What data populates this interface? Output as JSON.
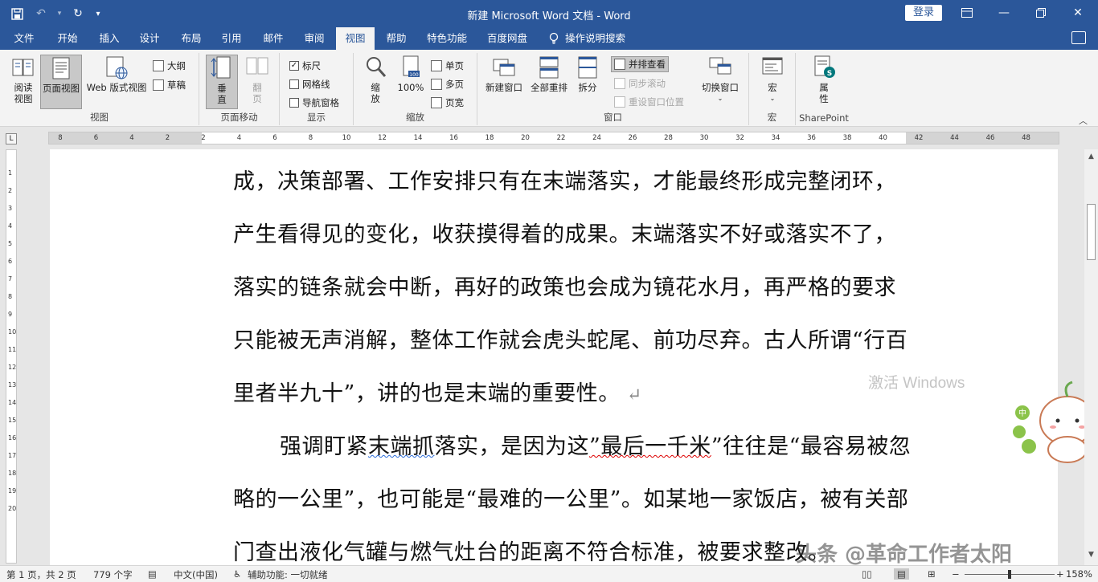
{
  "window": {
    "title": "新建 Microsoft Word 文档  -  Word",
    "login_label": "登录"
  },
  "tabs": [
    {
      "label": "文件"
    },
    {
      "label": "开始"
    },
    {
      "label": "插入"
    },
    {
      "label": "设计"
    },
    {
      "label": "布局"
    },
    {
      "label": "引用"
    },
    {
      "label": "邮件"
    },
    {
      "label": "审阅"
    },
    {
      "label": "视图",
      "active": true
    },
    {
      "label": "帮助"
    },
    {
      "label": "特色功能"
    },
    {
      "label": "百度网盘"
    }
  ],
  "tell_me": "操作说明搜索",
  "ribbon": {
    "views": {
      "read_mode": "阅读\n视图",
      "print_layout": "页面视图",
      "web_layout": "Web 版式视图",
      "outline": "大纲",
      "draft": "草稿",
      "label": "视图"
    },
    "page_movement": {
      "vertical": "垂\n直",
      "side_to_side": "翻\n页",
      "label": "页面移动"
    },
    "show": {
      "ruler": "标尺",
      "ruler_checked": true,
      "gridlines": "网格线",
      "gridlines_checked": false,
      "nav_pane": "导航窗格",
      "nav_pane_checked": false,
      "label": "显示"
    },
    "zoom": {
      "zoom": "缩\n放",
      "hundred": "100%",
      "one_page": "单页",
      "multi_page": "多页",
      "page_width": "页宽",
      "label": "缩放"
    },
    "window": {
      "new_window": "新建窗口",
      "arrange_all": "全部重排",
      "split": "拆分",
      "side_by_side": "并排查看",
      "sync_scroll": "同步滚动",
      "reset_pos": "重设窗口位置",
      "switch_windows": "切换窗口",
      "label": "窗口"
    },
    "macros": {
      "macros": "宏",
      "label": "宏"
    },
    "sharepoint": {
      "properties": "属\n性",
      "label": "SharePoint"
    }
  },
  "ruler": {
    "numbers": [
      "8",
      "6",
      "4",
      "2",
      "2",
      "4",
      "6",
      "8",
      "10",
      "12",
      "14",
      "16",
      "18",
      "20",
      "22",
      "24",
      "26",
      "28",
      "30",
      "32",
      "34",
      "36",
      "38",
      "40",
      "42",
      "44",
      "46",
      "48"
    ]
  },
  "vruler_numbers": [
    "1",
    "2",
    "3",
    "4",
    "5",
    "6",
    "7",
    "8",
    "9",
    "10",
    "11",
    "12",
    "13",
    "14",
    "15",
    "16",
    "17",
    "18",
    "19",
    "20"
  ],
  "document": {
    "lines": [
      "成，决策部署、工作安排只有在末端落实，才能最终形成完整闭环，",
      "产生看得见的变化，收获摸得着的成果。末端落实不好或落实不了，",
      "落实的链条就会中断，再好的政策也会成为镜花水月，再严格的要求",
      "只能被无声消解，整体工作就会虎头蛇尾、前功尽弃。古人所谓“行百",
      "里者半九十”，讲的也是末端的重要性。"
    ],
    "para2_line1_a": "强调盯紧",
    "para2_line1_b": "末端抓",
    "para2_line1_c": "落实，是因为这",
    "para2_line1_d": "”最后一千米",
    "para2_line1_e": "”往往是“最容易被忽",
    "para2_lines": [
      "略的一公里”，也可能是“最难的一公里”。如某地一家饭店，被有关部",
      "门查出液化气罐与燃气灶台的距离不符合标准，被要求整改。"
    ]
  },
  "watermark": {
    "activate": "激活 Windows",
    "toutiao": "头条 @革命工作者太阳"
  },
  "status": {
    "page": "第 1 页，共 2 页",
    "words": "779 个字",
    "language": "中文(中国)",
    "accessibility": "辅助功能: 一切就绪",
    "zoom": "158%",
    "zoom_percent": 158
  }
}
